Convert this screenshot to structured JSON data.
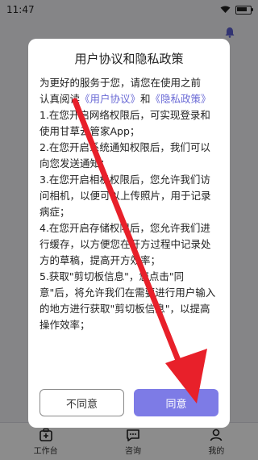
{
  "status_bar": {
    "time": "11:47"
  },
  "dialog": {
    "title": "用户协议和隐私政策",
    "intro_1": "为更好的服务于您，请您在使用之前",
    "intro_2": "认真阅读",
    "link_agreement": "《用户协议》",
    "and": "和",
    "link_privacy": "《隐私政策》",
    "p1": "1.在您开启网络权限后，可实现登录和使用甘草云管家App；",
    "p2": "2.在您开启系统通知权限后，我们可以向您发送通知；",
    "p3": "3.在您开启相机权限后，您允许我们访问相机，以便可以上传照片，用于记录病症；",
    "p4": "4.在您开启存储权限后，您允许我们进行缓存，以方便您在开方过程中记录处方的草稿，提高开方效率；",
    "p5": "5.获取\"剪切板信息\"，您点击\"同意\"后，将允许我们在需要进行用户输入的地方进行获取\"剪切板信息\"，以提高操作效率；",
    "btn_disagree": "不同意",
    "btn_agree": "同意"
  },
  "tabbar": {
    "items": [
      {
        "label": "工作台",
        "icon": "workbench-icon"
      },
      {
        "label": "咨询",
        "icon": "chat-icon"
      },
      {
        "label": "我的",
        "icon": "profile-icon"
      }
    ]
  },
  "colors": {
    "accent": "#7d7be6",
    "link": "#6b6bd6",
    "annotation_arrow": "#e8202a"
  }
}
